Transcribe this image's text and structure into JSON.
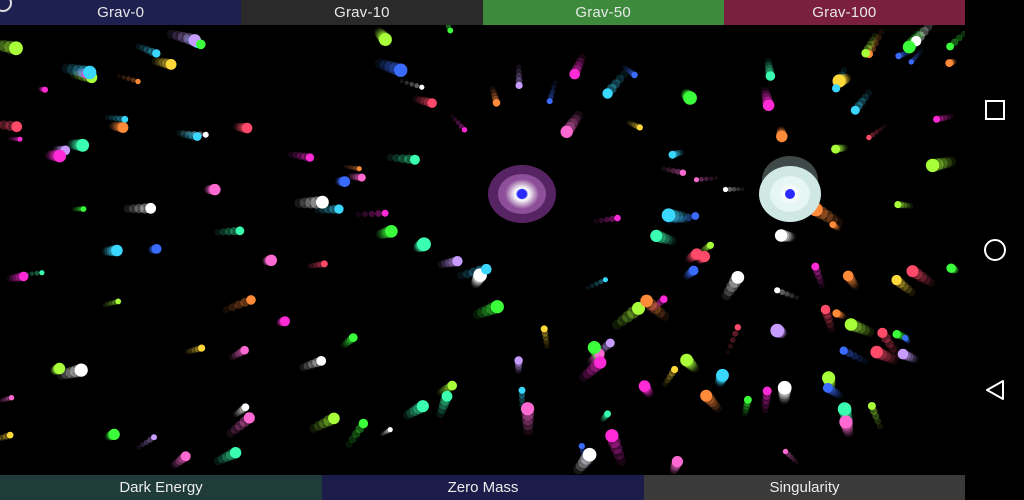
{
  "gravity_tabs": [
    {
      "label": "Grav-0",
      "color": "#1e2050"
    },
    {
      "label": "Grav-10",
      "color": "#2a2a2a"
    },
    {
      "label": "Grav-50",
      "color": "#3d8a3d"
    },
    {
      "label": "Grav-100",
      "color": "#7a1f3d"
    }
  ],
  "mode_buttons": [
    {
      "label": "Dark Energy",
      "color": "#1f3b3a"
    },
    {
      "label": "Zero Mass",
      "color": "#1c1c4a"
    },
    {
      "label": "Singularity",
      "color": "#3a3a3a"
    }
  ],
  "navigation": {
    "recent_icon": "square-icon",
    "home_icon": "circle-icon",
    "back_icon": "triangle-back-icon"
  },
  "attractors": [
    {
      "name": "purple-attractor",
      "glow": "#6a2a7a"
    },
    {
      "name": "white-attractor",
      "glow": "#cfe8e4"
    }
  ]
}
